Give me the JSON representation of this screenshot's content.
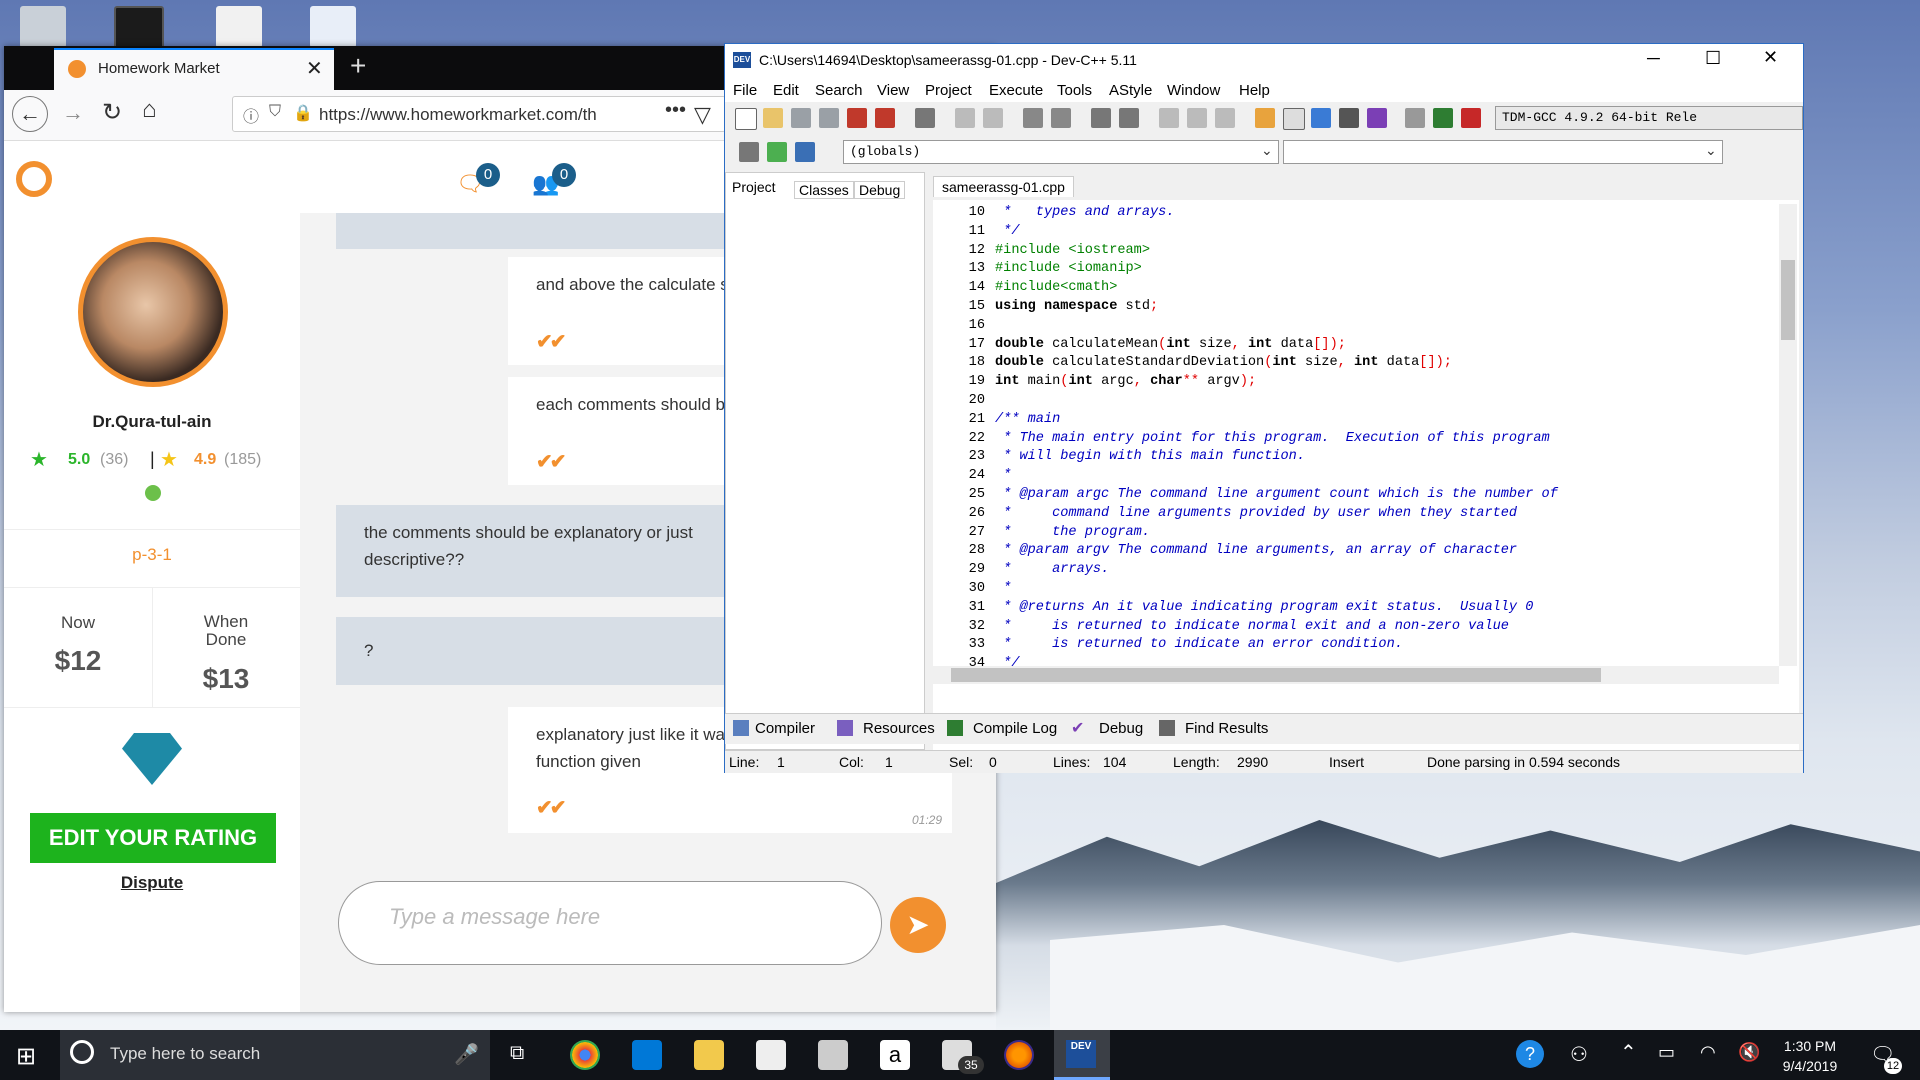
{
  "browser": {
    "tab_title": "Homework Market",
    "url": "https://www.homeworkmarket.com/th",
    "header": {
      "badge_notifications": "0",
      "badge_messages": "0"
    },
    "profile": {
      "name": "Dr.Qura-tul-ain",
      "rating1": "5.0",
      "rating1_count": "(36)",
      "rating2": "4.9",
      "rating2_count": "(185)",
      "project_id": "p-3-1",
      "price_now_label": "Now",
      "price_now": "$12",
      "price_done_label_1": "When",
      "price_done_label_2": "Done",
      "price_done": "$13",
      "edit_rating": "EDIT YOUR RATING",
      "dispute": "Dispute"
    },
    "chat": {
      "messages": [
        {
          "dir": "out",
          "text": "and above the calculate s deviation"
        },
        {
          "dir": "out",
          "text": "each comments should b respectively"
        },
        {
          "dir": "in",
          "text": "the comments should be explanatory or just descriptive??"
        },
        {
          "dir": "in",
          "text": "?"
        },
        {
          "dir": "out",
          "text": "explanatory just like it wa question for the main function given",
          "time": "01:29"
        }
      ],
      "input_placeholder": "Type a message here"
    }
  },
  "devcpp": {
    "title": "C:\\Users\\14694\\Desktop\\sameerassg-01.cpp - Dev-C++ 5.11",
    "menu": [
      "File",
      "Edit",
      "Search",
      "View",
      "Project",
      "Execute",
      "Tools",
      "AStyle",
      "Window",
      "Help"
    ],
    "compiler_select": "TDM-GCC 4.9.2 64-bit Rele",
    "scope_select": "(globals)",
    "left_tabs": [
      "Project",
      "Classes",
      "Debug"
    ],
    "file_tab": "sameerassg-01.cpp",
    "line_numbers": [
      "10",
      "11",
      "12",
      "13",
      "14",
      "15",
      "16",
      "17",
      "18",
      "19",
      "20",
      "21",
      "22",
      "23",
      "24",
      "25",
      "26",
      "27",
      "28",
      "29",
      "30",
      "31",
      "32",
      "33",
      "34"
    ],
    "bottom_tabs": [
      "Compiler",
      "Resources",
      "Compile Log",
      "Debug",
      "Find Results"
    ],
    "status": {
      "line_label": "Line:",
      "line": "1",
      "col_label": "Col:",
      "col": "1",
      "sel_label": "Sel:",
      "sel": "0",
      "lines_label": "Lines:",
      "lines": "104",
      "length_label": "Length:",
      "length": "2990",
      "mode": "Insert",
      "message": "Done parsing in 0.594 seconds"
    }
  },
  "taskbar": {
    "search_placeholder": "Type here to search",
    "time": "1:30 PM",
    "date": "9/4/2019",
    "mail_count": "35",
    "notif_count": "12"
  }
}
